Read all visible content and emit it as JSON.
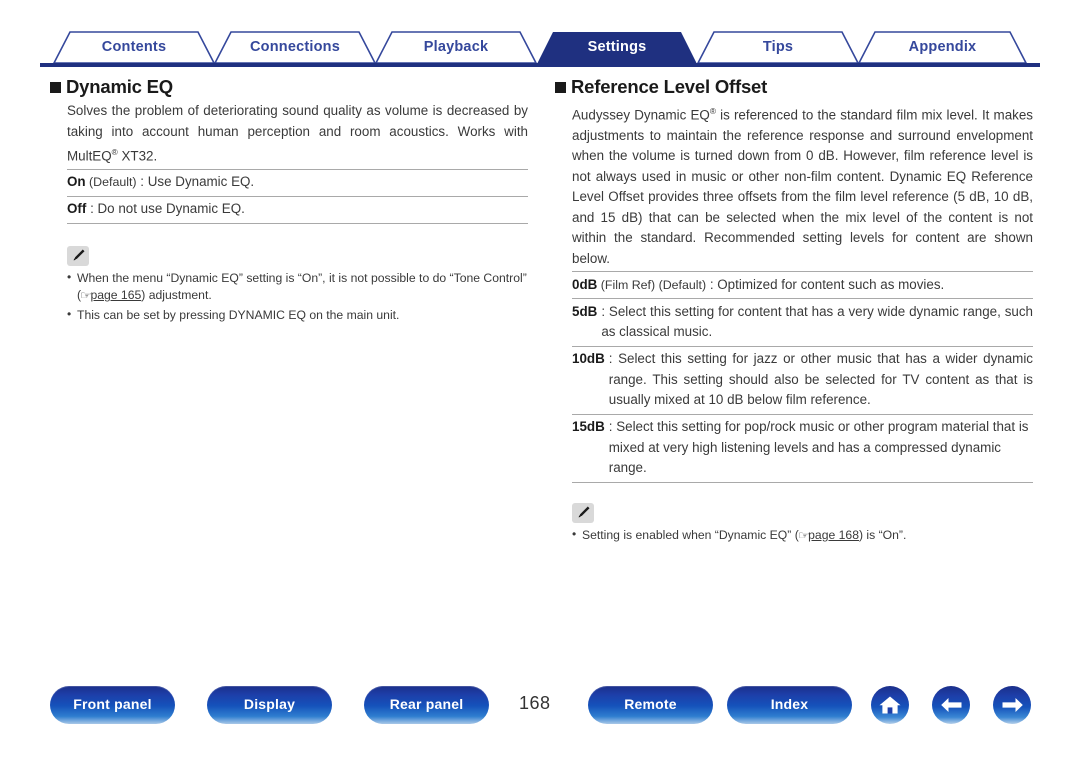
{
  "tabs": [
    {
      "label": "Contents",
      "active": false
    },
    {
      "label": "Connections",
      "active": false
    },
    {
      "label": "Playback",
      "active": false
    },
    {
      "label": "Settings",
      "active": true
    },
    {
      "label": "Tips",
      "active": false
    },
    {
      "label": "Appendix",
      "active": false
    }
  ],
  "colors": {
    "tab_active_bg": "#1f3080",
    "tab_inactive_text": "#35489c",
    "underline": "#1f3080",
    "button_blue": "#1552bb",
    "body_text": "#3a3a3a"
  },
  "left": {
    "title": "Dynamic EQ",
    "paragraph": "Solves the problem of deteriorating sound quality as volume is decreased by taking into account human perception and room acoustics. Works with MultEQ",
    "paragraph_sup": "®",
    "paragraph_tail": " XT32.",
    "options": [
      {
        "term": "On",
        "paren": " (Default)",
        "desc": " : Use Dynamic EQ."
      },
      {
        "term": "Off",
        "paren": "",
        "desc": " : Do not use Dynamic EQ."
      }
    ],
    "note_icon": "pencil-icon",
    "notes": [
      {
        "pre": "When the menu “Dynamic EQ” setting is “On”, it is not possible to do “Tone Control” (",
        "ref": "page 165",
        "post": ") adjustment."
      },
      {
        "pre": "This can be set by pressing DYNAMIC EQ on the main unit.",
        "ref": "",
        "post": ""
      }
    ]
  },
  "right": {
    "title": "Reference Level Offset",
    "paragraph_head": "Audyssey Dynamic EQ",
    "paragraph_sup": "®",
    "paragraph_body": " is referenced to the standard film mix level. It makes adjustments to maintain the reference response and surround envelopment when the volume is turned down from 0 dB. However, film reference level is not always used in music or other non-film content. Dynamic EQ Reference Level Offset provides three offsets from the film level reference (5 dB, 10 dB, and 15 dB) that can be selected when the mix level of the content is not within the standard. Recommended setting levels for content are shown below.",
    "options": [
      {
        "term": "0dB",
        "paren": " (Film Ref) (Default)",
        "desc": " : Optimized for content such as movies.",
        "hang": false
      },
      {
        "term": "5dB",
        "paren": "",
        "desc": ": Select this setting for content that has a very wide dynamic range, such as classical music.",
        "hang": true
      },
      {
        "term": "10dB",
        "paren": "",
        "desc": ": Select this setting for jazz or other music that has a wider dynamic range. This setting should also be selected for TV content as that is usually mixed at 10 dB below film reference.",
        "hang": true
      },
      {
        "term": "15dB",
        "paren": "",
        "desc": ": Select this setting for pop/rock music or other program material that is mixed at very high listening levels and has a compressed dynamic range.",
        "hang": true
      }
    ],
    "note_icon": "pencil-icon",
    "notes": [
      {
        "pre": "Setting is enabled when “Dynamic EQ” (",
        "ref": "page 168",
        "post": ") is “On”."
      }
    ]
  },
  "footer": {
    "buttons": [
      {
        "label": "Front panel",
        "name": "front-panel-button"
      },
      {
        "label": "Display",
        "name": "display-button"
      },
      {
        "label": "Rear panel",
        "name": "rear-panel-button"
      },
      {
        "label": "Remote",
        "name": "remote-button"
      },
      {
        "label": "Index",
        "name": "index-button"
      }
    ],
    "page_number": "168",
    "icons": [
      {
        "name": "home-icon"
      },
      {
        "name": "arrow-left-icon"
      },
      {
        "name": "arrow-right-icon"
      }
    ]
  }
}
